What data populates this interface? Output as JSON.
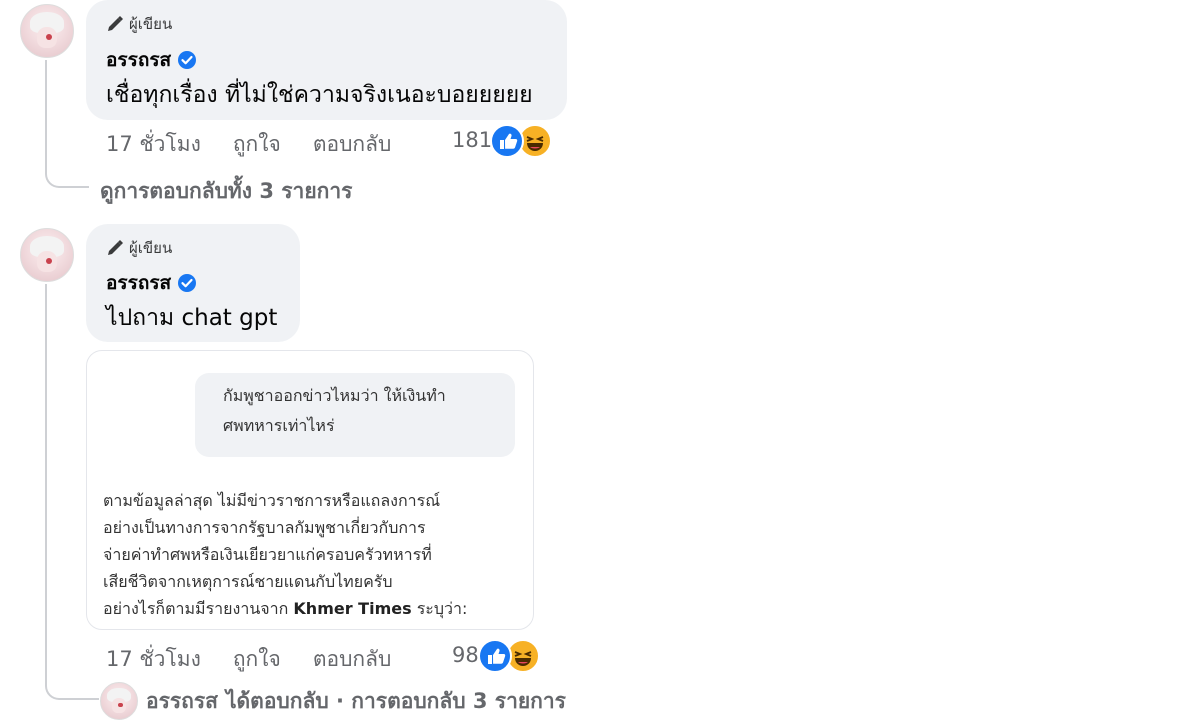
{
  "comments": [
    {
      "author_badge": "ผู้เขียน",
      "name": "อรรถรส",
      "text": "เชื่อทุกเรื่อง ที่ไม่ใช่ความจริงเนอะบอยยยยย",
      "time": "17 ชั่วโมง",
      "like_label": "ถูกใจ",
      "reply_label": "ตอบกลับ",
      "reaction_count": "181",
      "view_replies": "ดูการตอบกลับทั้ง 3 รายการ"
    },
    {
      "author_badge": "ผู้เขียน",
      "name": "อรรถรส",
      "text": "ไปถาม chat gpt",
      "attachment": {
        "question_line1": "กัมพูชาออกข่าวไหมว่า ให้เงินทำ",
        "question_line2": "ศพทหารเท่าไหร่",
        "answer_lines": [
          "ตามข้อมูลล่าสุด ไม่มีข่าวราชการหรือแถลงการณ์",
          "อย่างเป็นทางการจากรัฐบาลกัมพูชาเกี่ยวกับการ",
          "จ่ายค่าทำศพหรือเงินเยียวยาแก่ครอบครัวทหารที่",
          "เสียชีวิตจากเหตุการณ์ชายแดนกับไทยครับ"
        ],
        "answer_last_prefix": "อย่างไรก็ตามมีรายงานจาก ",
        "answer_last_bold": "Khmer Times",
        "answer_last_suffix": " ระบุว่า:"
      },
      "time": "17 ชั่วโมง",
      "like_label": "ถูกใจ",
      "reply_label": "ตอบกลับ",
      "reaction_count": "98",
      "reply_summary_name": "อรรถรส",
      "reply_summary_text": "ได้ตอบกลับ · การตอบกลับ 3 รายการ"
    }
  ],
  "colors": {
    "bubble": "#f0f2f5",
    "like_blue": "#1877f2",
    "haha_yellow": "#f7b125",
    "meta_gray": "#65676b"
  },
  "icons": [
    "pen-icon",
    "verified-badge-icon",
    "like-reaction-icon",
    "haha-reaction-icon"
  ]
}
